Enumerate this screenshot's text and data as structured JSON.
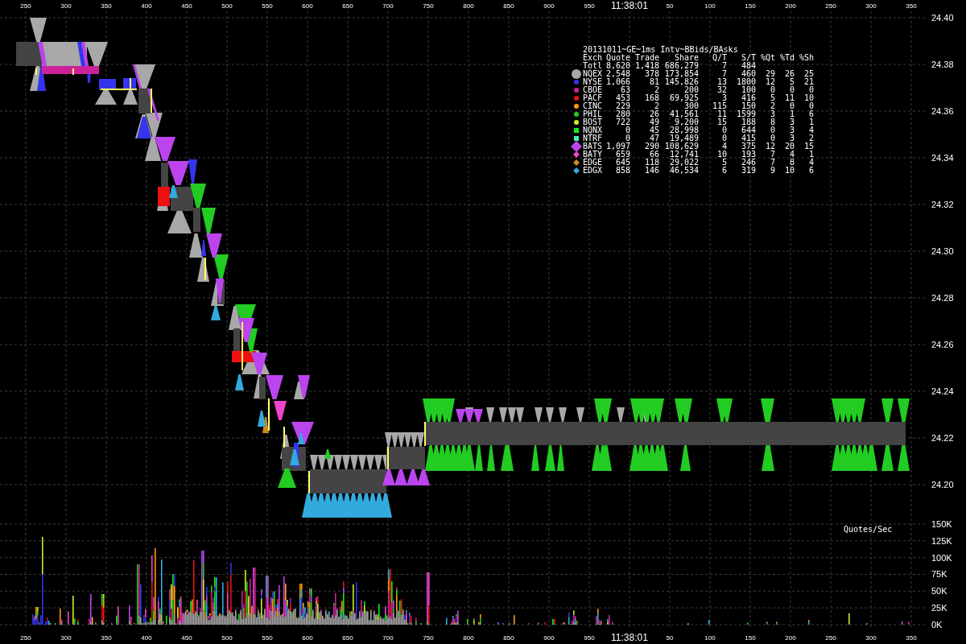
{
  "chart": {
    "time_axis_top": {
      "before": [
        "250",
        "300",
        "350",
        "400",
        "450",
        "500",
        "550",
        "600",
        "650",
        "700",
        "750",
        "800",
        "850",
        "900",
        "950"
      ],
      "time": "11:38:01",
      "after": [
        "50",
        "100",
        "150",
        "200",
        "250",
        "300",
        "350"
      ]
    },
    "price_axis": [
      "24.40",
      "24.38",
      "24.36",
      "24.34",
      "24.32",
      "24.30",
      "24.28",
      "24.26",
      "24.24",
      "24.22",
      "24.20"
    ],
    "volume_axis": [
      "150K",
      "125K",
      "100K",
      "75K",
      "50K",
      "25K",
      "0K"
    ],
    "volume_title": "Quotes/Sec",
    "time_axis_bottom": {
      "before": [
        "250",
        "300",
        "350",
        "400",
        "450",
        "500",
        "550",
        "600",
        "650",
        "700",
        "750",
        "800",
        "850",
        "900",
        "950"
      ],
      "time": "11:38:01",
      "after": [
        "50",
        "100",
        "150",
        "200",
        "250",
        "300",
        "350"
      ]
    }
  },
  "legend": {
    "title": "20131011~GE~1ms Intv~BBids/BAsks",
    "columns": [
      "Exch",
      "Quote",
      "Trade",
      "Share",
      "Q/T",
      "S/T",
      "%Qt",
      "%Td",
      "%Sh"
    ],
    "total": [
      "Totl",
      "8,620",
      "1,418",
      "686,279",
      "7",
      "484"
    ],
    "rows": [
      {
        "kind": "large-circle",
        "color": "#a8a8a8",
        "cells": [
          "NQEX",
          "2,548",
          "378",
          "173,854",
          "7",
          "460",
          "29",
          "26",
          "25"
        ]
      },
      {
        "kind": "circle",
        "color": "#3535ee",
        "cells": [
          "NYSE",
          "1,066",
          "81",
          "145,826",
          "13",
          "1800",
          "12",
          "5",
          "21"
        ]
      },
      {
        "kind": "circle",
        "color": "#cc2299",
        "cells": [
          "CBOE",
          "63",
          "2",
          "200",
          "32",
          "100",
          "0",
          "0",
          "0"
        ]
      },
      {
        "kind": "circle",
        "color": "#ee1111",
        "cells": [
          "PACF",
          "453",
          "168",
          "69,925",
          "3",
          "416",
          "5",
          "11",
          "10"
        ]
      },
      {
        "kind": "circle",
        "color": "#ff9911",
        "cells": [
          "CINC",
          "229",
          "2",
          "300",
          "115",
          "150",
          "2",
          "0",
          "0"
        ]
      },
      {
        "kind": "circle",
        "color": "#22cc22",
        "cells": [
          "PHIL",
          "280",
          "26",
          "41,561",
          "11",
          "1599",
          "3",
          "1",
          "6"
        ]
      },
      {
        "kind": "circle",
        "color": "#ccee22",
        "cells": [
          "BOST",
          "722",
          "49",
          "9,200",
          "15",
          "188",
          "8",
          "3",
          "1"
        ]
      },
      {
        "kind": "square",
        "color": "#11ee11",
        "cells": [
          "NQNX",
          "0",
          "45",
          "28,998",
          "0",
          "644",
          "0",
          "3",
          "4"
        ]
      },
      {
        "kind": "square",
        "color": "#44eebb",
        "cells": [
          "NTRF",
          "0",
          "47",
          "19,489",
          "0",
          "415",
          "0",
          "3",
          "2"
        ]
      },
      {
        "kind": "large-diamond",
        "color": "#bb44ee",
        "cells": [
          "BATS",
          "1,097",
          "290",
          "108,629",
          "4",
          "375",
          "12",
          "20",
          "15"
        ]
      },
      {
        "kind": "diamond",
        "color": "#ee44cc",
        "cells": [
          "BATY",
          "659",
          "66",
          "12,741",
          "10",
          "193",
          "7",
          "4",
          "1"
        ]
      },
      {
        "kind": "diamond",
        "color": "#cc8822",
        "cells": [
          "EDGE",
          "645",
          "118",
          "29,022",
          "5",
          "246",
          "7",
          "8",
          "4"
        ]
      },
      {
        "kind": "diamond",
        "color": "#33aadd",
        "cells": [
          "EDGX",
          "858",
          "146",
          "46,534",
          "6",
          "319",
          "9",
          "10",
          "6"
        ]
      }
    ]
  }
}
